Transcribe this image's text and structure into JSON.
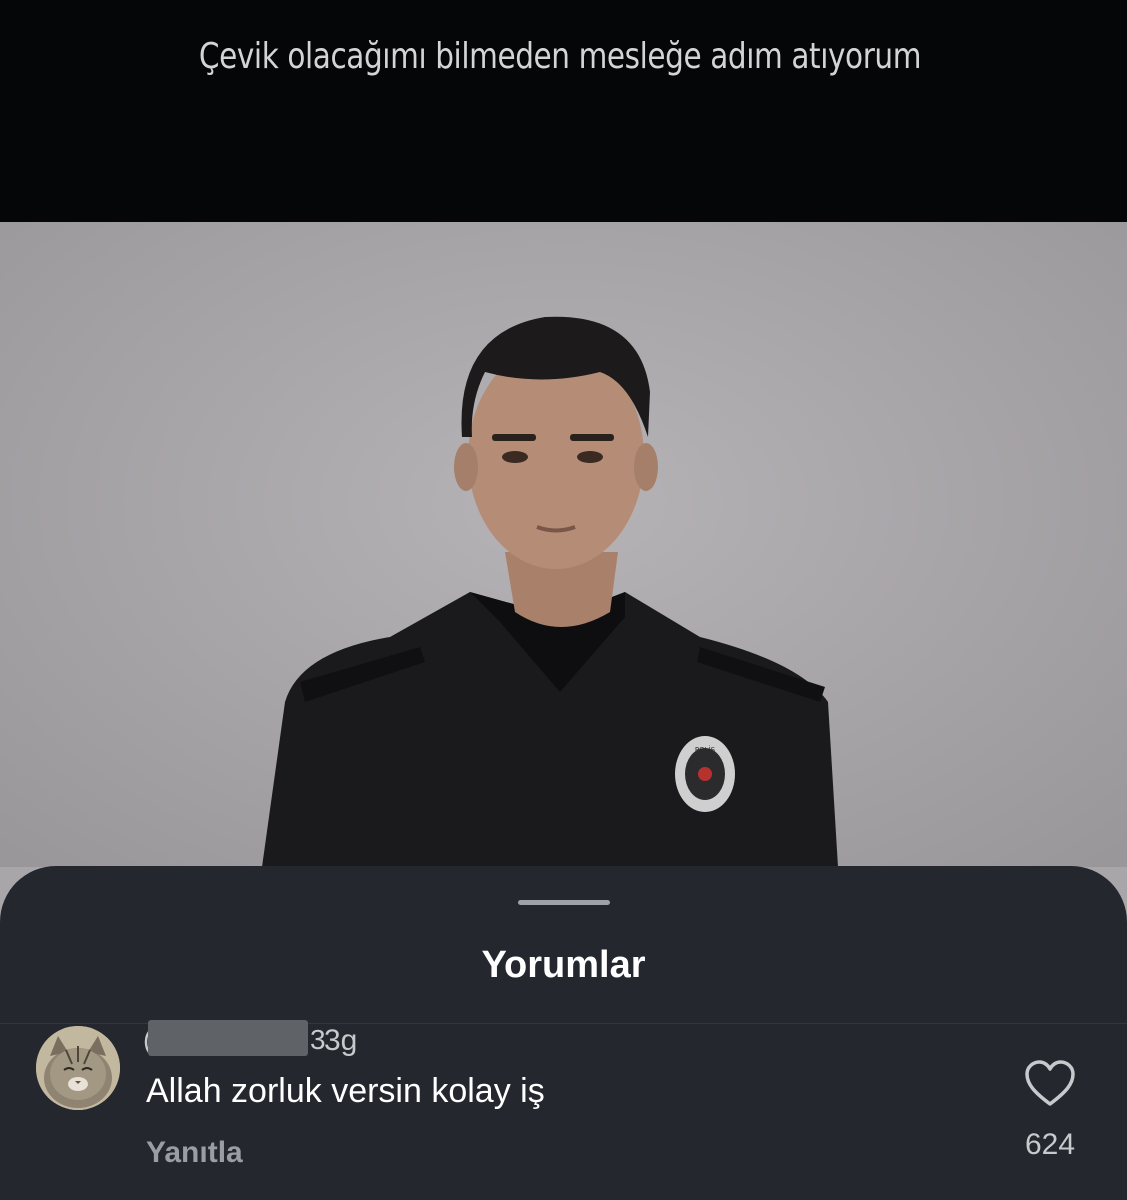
{
  "video": {
    "caption": "Çevik olacağımı bilmeden mesleğe adım atıyorum",
    "badge_text": "POLİS"
  },
  "comments_sheet": {
    "title": "Yorumlar",
    "comments": [
      {
        "username_visible_start": "(",
        "username_visible_end": "3",
        "time": "3g",
        "text": "Allah zorluk versin kolay iş",
        "reply_label": "Yanıtla",
        "like_count": "624",
        "avatar_icon": "cat-avatar"
      }
    ]
  },
  "colors": {
    "sheet_background": "#24272d",
    "top_bar": "#050607",
    "photo_background": "#a9a6aa"
  }
}
